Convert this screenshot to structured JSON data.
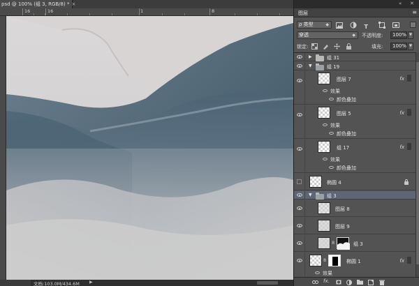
{
  "document": {
    "tab_title": "psd @ 100% (组 3, RGB/8) *",
    "close_glyph": "×"
  },
  "ruler": {
    "labels": [
      "16",
      "16",
      "1",
      "8"
    ]
  },
  "status": {
    "doc_info": "文档:103.0M/434.6M",
    "arrow_glyph": "▶"
  },
  "layers_panel": {
    "title": "图层",
    "menu_glyph": "≡",
    "top_icons": [
      "collapse-icon",
      "close-icon"
    ],
    "filter": {
      "kind_label": "ρ 类型",
      "icons": [
        "image-filter-icon",
        "adjustment-filter-icon",
        "type-filter-icon",
        "shape-filter-icon",
        "smart-object-filter-icon"
      ],
      "type_glyph": "T"
    },
    "blend_mode": "穿透",
    "opacity_label": "不透明度:",
    "opacity_value": "100%",
    "lock_label": "锁定:",
    "lock_icons": [
      "lock-transparent-icon",
      "lock-paint-icon",
      "lock-position-icon",
      "lock-all-icon"
    ],
    "fill_label": "填充:",
    "fill_value": "100%",
    "layers": [
      {
        "name": "组 31",
        "type": "group",
        "expanded": false,
        "visible": true
      },
      {
        "name": "组 19",
        "type": "group",
        "expanded": true,
        "visible": true
      },
      {
        "name": "图层 7",
        "type": "layer",
        "visible": true,
        "fx": "fx",
        "effects_label": "效果",
        "effect": "颜色叠加"
      },
      {
        "name": "图层 5",
        "type": "layer",
        "visible": true,
        "fx": "fx",
        "effects_label": "效果",
        "effect": "颜色叠加"
      },
      {
        "name": "组 17",
        "type": "layer",
        "visible": true,
        "fx": "fx",
        "effects_label": "效果",
        "effect": "颜色叠加"
      },
      {
        "name": "椭圆 4",
        "type": "shape",
        "visible": false,
        "locked": true
      },
      {
        "name": "组 3",
        "type": "group",
        "expanded": true,
        "visible": true,
        "selected": true
      },
      {
        "name": "图层 8",
        "type": "layer",
        "visible": true
      },
      {
        "name": "图层 9",
        "type": "layer",
        "visible": true
      },
      {
        "name": "组 3",
        "type": "masked",
        "visible": true,
        "chain": "8"
      },
      {
        "name": "椭圆 1",
        "type": "masked",
        "visible": true,
        "chain": "8",
        "fx": "fx",
        "effects_label": "效果"
      }
    ],
    "footer_icons": [
      "link-layers-icon",
      "fx-icon",
      "add-mask-icon",
      "adjustment-layer-icon",
      "new-group-icon",
      "new-layer-icon",
      "delete-layer-icon"
    ],
    "footer_fx": "fx."
  },
  "colors": {
    "panel_bg": "#535353",
    "selected_row": "#5e6675",
    "canvas_sky": "#d3d1d1",
    "mountain_dark": "#4c6273"
  }
}
